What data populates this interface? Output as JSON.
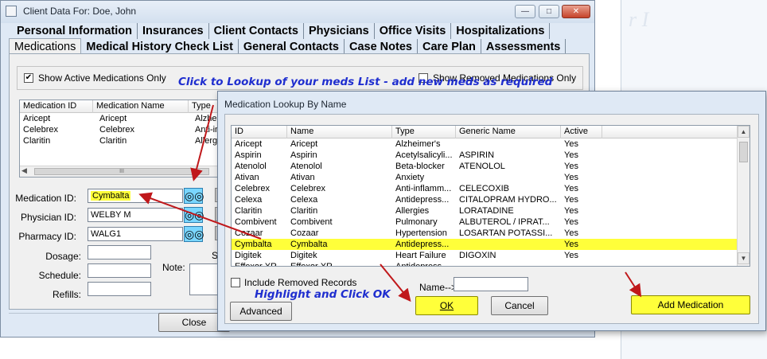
{
  "background": {
    "faint_text": "r I"
  },
  "window": {
    "title": "Client Data For: Doe, John",
    "icons": {
      "minimize": "minimize-icon",
      "maximize": "maximize-icon",
      "close": "close-icon"
    }
  },
  "tabs": {
    "row1": [
      "Personal Information",
      "Insurances",
      "Client Contacts",
      "Physicians",
      "Office Visits",
      "Hospitalizations"
    ],
    "row2": [
      "Medications",
      "Medical History Check List",
      "General Contacts",
      "Case Notes",
      "Care Plan",
      "Assessments"
    ]
  },
  "medications": {
    "show_active_label": "Show Active Medications Only",
    "show_active_checked": true,
    "show_removed_label": "Show Removed Medications Only",
    "show_removed_checked": false,
    "list": {
      "columns": [
        "Medication ID",
        "Medication Name",
        "Type"
      ],
      "rows": [
        [
          "Aricept",
          "Aricept",
          "Alzhei"
        ],
        [
          "Celebrex",
          "Celebrex",
          "Anti-in"
        ],
        [
          "Claritin",
          "Claritin",
          "Allerg"
        ]
      ]
    },
    "scroll_grip": "III",
    "fields": {
      "medication_id_label": "Medication ID:",
      "medication_id_value": "Cymbalta",
      "physician_id_label": "Physician ID:",
      "physician_id_value": "WELBY M",
      "pharmacy_id_label": "Pharmacy ID:",
      "pharmacy_id_value": "WALG1",
      "dosage_label": "Dosage:",
      "schedule_label": "Schedule:",
      "refills_label": "Refills:",
      "note_label": "Note:",
      "s_label": "S"
    },
    "close_button": "Close"
  },
  "annotations": {
    "top": "Click  to Lookup of your meds List - add new meds as required",
    "bottom": "Highlight and Click OK"
  },
  "lookup": {
    "title": "Medication Lookup By Name",
    "columns": [
      "ID",
      "Name",
      "Type",
      "Generic Name",
      "Active"
    ],
    "rows": [
      [
        "Aricept",
        "Aricept",
        "Alzheimer's",
        "",
        "Yes"
      ],
      [
        "Aspirin",
        "Aspirin",
        "Acetylsalicyli...",
        "ASPIRIN",
        "Yes"
      ],
      [
        "Atenolol",
        "Atenolol",
        "Beta-blocker",
        "ATENOLOL",
        "Yes"
      ],
      [
        "Ativan",
        "Ativan",
        "Anxiety",
        "",
        "Yes"
      ],
      [
        "Celebrex",
        "Celebrex",
        "Anti-inflamm...",
        "CELECOXIB",
        "Yes"
      ],
      [
        "Celexa",
        "Celexa",
        "Antidepress...",
        "CITALOPRAM HYDRO...",
        "Yes"
      ],
      [
        "Claritin",
        "Claritin",
        "Allergies",
        "LORATADINE",
        "Yes"
      ],
      [
        "Combivent",
        "Combivent",
        "Pulmonary",
        "ALBUTEROL / IPRAT...",
        "Yes"
      ],
      [
        "Cozaar",
        "Cozaar",
        "Hypertension",
        "LOSARTAN POTASSI...",
        "Yes"
      ],
      [
        "Cymbalta",
        "Cymbalta",
        "Antidepress...",
        "",
        "Yes"
      ],
      [
        "Digitek",
        "Digitek",
        "Heart Failure",
        "DIGOXIN",
        "Yes"
      ],
      [
        "Effexor XR",
        "Effexor XR",
        "Antidepress...",
        "",
        ""
      ]
    ],
    "selected_row": 9,
    "include_removed_label": "Include Removed Records",
    "include_removed_checked": false,
    "name_label": "Name-->",
    "name_value": "",
    "ok_label": "OK",
    "cancel_label": "Cancel",
    "advanced_label": "Advanced",
    "add_medication_label": "Add Medication",
    "highlight_color": "#ffff3a",
    "annotation_color": "#1f2ecf",
    "arrow_color": "#c0181b"
  }
}
